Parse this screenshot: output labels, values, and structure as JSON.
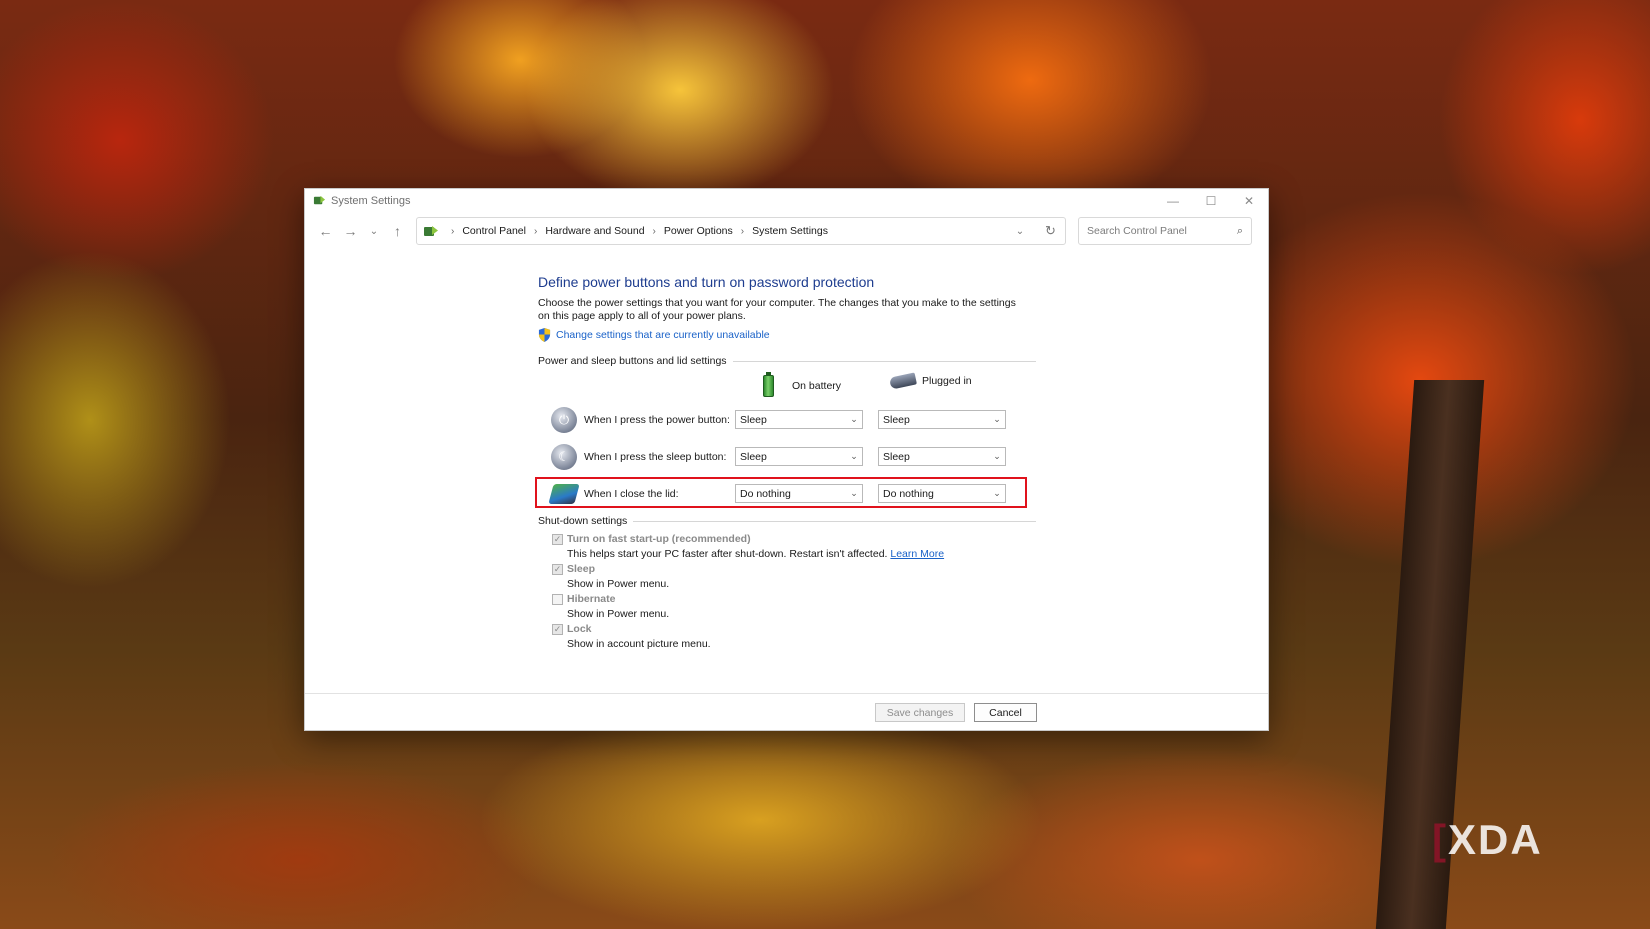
{
  "window": {
    "title": "System Settings"
  },
  "titlebar": {
    "minimize": "—",
    "maximize": "☐",
    "close": "✕"
  },
  "nav": {
    "back": "←",
    "forward": "→",
    "recent": "⌄",
    "up": "↑"
  },
  "breadcrumb": [
    "Control Panel",
    "Hardware and Sound",
    "Power Options",
    "System Settings"
  ],
  "address": {
    "dropdown": "⌄",
    "refresh": "↻"
  },
  "search": {
    "placeholder": "Search Control Panel",
    "icon": "⌕"
  },
  "page": {
    "title": "Define power buttons and turn on password protection",
    "description": "Choose the power settings that you want for your computer. The changes that you make to the settings on this page apply to all of your power plans.",
    "change_link": "Change settings that are currently unavailable"
  },
  "power_section": {
    "label": "Power and sleep buttons and lid settings",
    "col_battery": "On battery",
    "col_plugged": "Plugged in",
    "rows": [
      {
        "label": "When I press the power button:",
        "battery": "Sleep",
        "plugged": "Sleep",
        "icon": "power-icon"
      },
      {
        "label": "When I press the sleep button:",
        "battery": "Sleep",
        "plugged": "Sleep",
        "icon": "moon-icon"
      },
      {
        "label": "When I close the lid:",
        "battery": "Do nothing",
        "plugged": "Do nothing",
        "icon": "laptop-lid-icon"
      }
    ],
    "dropdown_arrow": "⌄"
  },
  "shutdown": {
    "label": "Shut-down settings",
    "items": [
      {
        "title": "Turn on fast start-up (recommended)",
        "desc": "This helps start your PC faster after shut-down. Restart isn't affected.",
        "link": "Learn More",
        "checked": true
      },
      {
        "title": "Sleep",
        "desc": "Show in Power menu.",
        "checked": true
      },
      {
        "title": "Hibernate",
        "desc": "Show in Power menu.",
        "checked": false
      },
      {
        "title": "Lock",
        "desc": "Show in account picture menu.",
        "checked": true
      }
    ],
    "check_glyph": "✓"
  },
  "footer": {
    "save": "Save changes",
    "cancel": "Cancel"
  },
  "watermark": {
    "mark": "[",
    "text": "XDA"
  },
  "colors": {
    "highlight": "#e0121c",
    "link": "#1a62c8",
    "title": "#1e3d8f"
  }
}
